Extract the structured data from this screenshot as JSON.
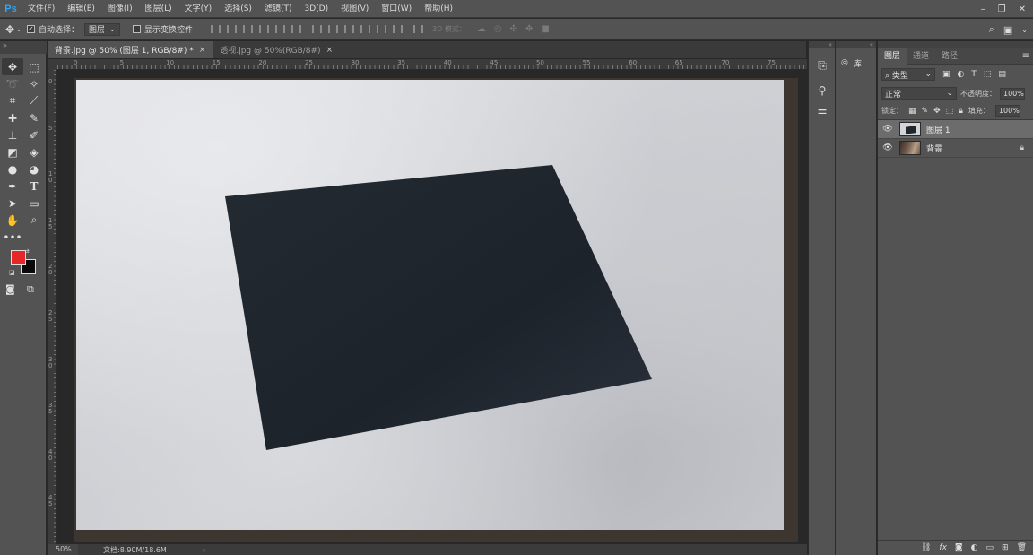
{
  "app": {
    "logo": "Ps"
  },
  "menu": [
    "文件(F)",
    "编辑(E)",
    "图像(I)",
    "图层(L)",
    "文字(Y)",
    "选择(S)",
    "滤镜(T)",
    "3D(D)",
    "视图(V)",
    "窗口(W)",
    "帮助(H)"
  ],
  "window_controls": {
    "minimize": "–",
    "restore": "❐",
    "close": "✕"
  },
  "options": {
    "auto_select_label": "自动选择：",
    "auto_select_value": "图层",
    "show_transform_label": "显示变换控件",
    "mode_3d_label": "3D 模式："
  },
  "tabs": [
    {
      "label": "背景.jpg @ 50% (图层 1, RGB/8#) *",
      "close": "×"
    },
    {
      "label": "透视.jpg @ 50%(RGB/8#)",
      "close": "×"
    }
  ],
  "ruler": {
    "h_labels": [
      "0",
      "5",
      "10",
      "15",
      "20",
      "25",
      "30",
      "35",
      "40",
      "45",
      "50",
      "55",
      "60",
      "65",
      "70",
      "75"
    ],
    "v_labels": [
      "0",
      "5",
      "1\n0",
      "1\n5",
      "2\n0",
      "2\n5",
      "3\n0",
      "3\n5",
      "4\n0",
      "4\n5"
    ]
  },
  "status": {
    "zoom": "50%",
    "doc_info": "文档:8.90M/18.6M",
    "arrow": "›"
  },
  "library": {
    "label": "库"
  },
  "layers_panel": {
    "tabs": [
      "图层",
      "通道",
      "路径"
    ],
    "filter_label": "类型",
    "blend_mode": "正常",
    "opacity_label": "不透明度：",
    "opacity_value": "100%",
    "lock_label": "锁定：",
    "fill_label": "填充：",
    "fill_value": "100%",
    "layers": [
      {
        "name": "图层 1",
        "selected": true
      },
      {
        "name": "背景",
        "locked": true
      }
    ]
  }
}
